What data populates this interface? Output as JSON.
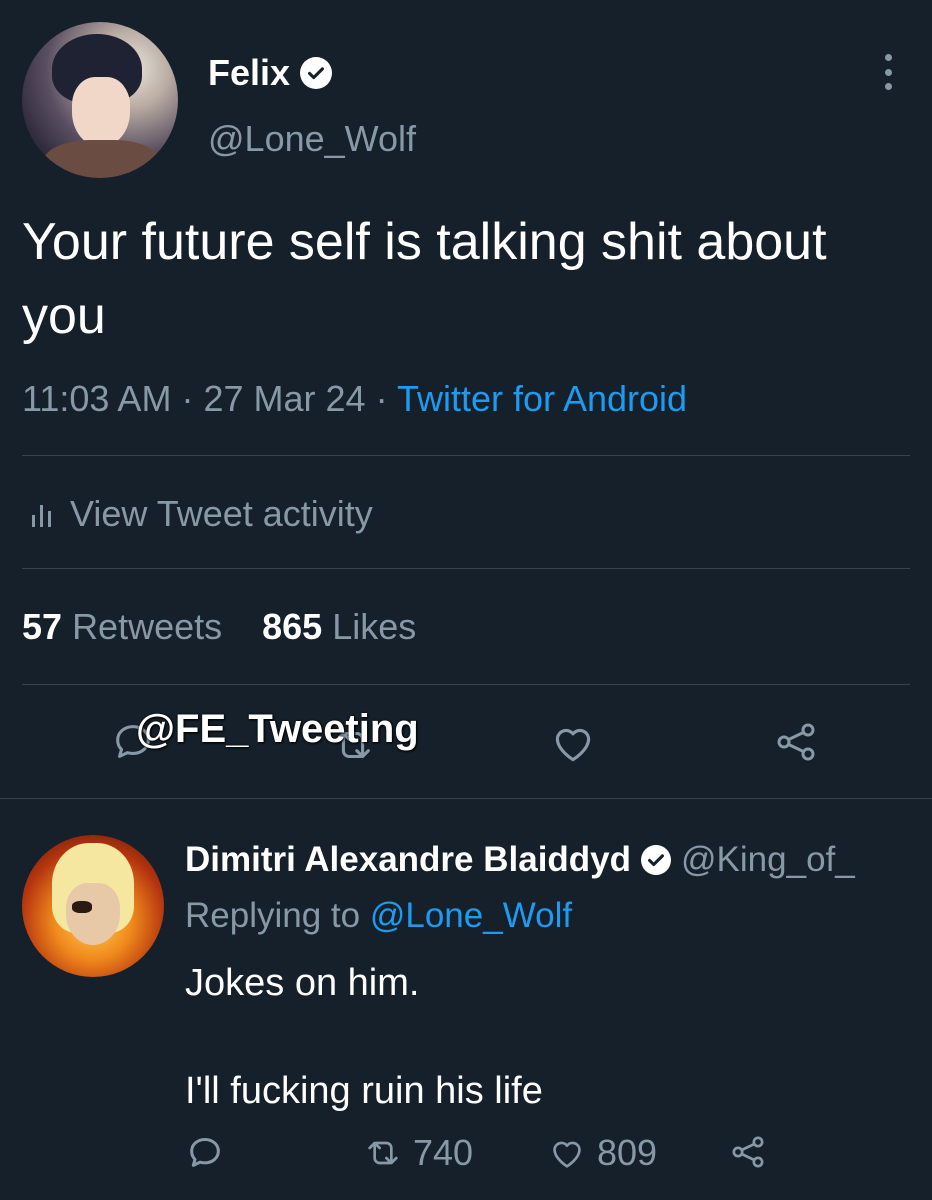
{
  "tweet": {
    "author": {
      "display_name": "Felix",
      "handle": "@Lone_Wolf",
      "verified": true
    },
    "text": "Your future self is talking shit about you",
    "time": "11:03 AM",
    "date": "27 Mar 24",
    "separator": "·",
    "source": "Twitter for Android",
    "activity_label": "View Tweet activity",
    "retweets": {
      "count": "57",
      "label": "Retweets"
    },
    "likes": {
      "count": "865",
      "label": "Likes"
    },
    "watermark": "@FE_Tweeting"
  },
  "reply": {
    "author": {
      "display_name": "Dimitri Alexandre Blaiddyd",
      "handle": "@King_of_",
      "verified": true
    },
    "replying_prefix": "Replying to",
    "replying_to": "@Lone_Wolf",
    "text": "Jokes on him.\n\nI'll fucking ruin his life",
    "retweets": "740",
    "likes": "809"
  },
  "colors": {
    "background": "#15202b",
    "divider": "#38444d",
    "secondary_text": "#8899a6",
    "link": "#1d9bf0",
    "primary_text": "#ffffff"
  },
  "icons": [
    "verified-badge-icon",
    "more-options-icon",
    "analytics-bars-icon",
    "reply-icon",
    "retweet-icon",
    "like-heart-icon",
    "share-icon"
  ]
}
